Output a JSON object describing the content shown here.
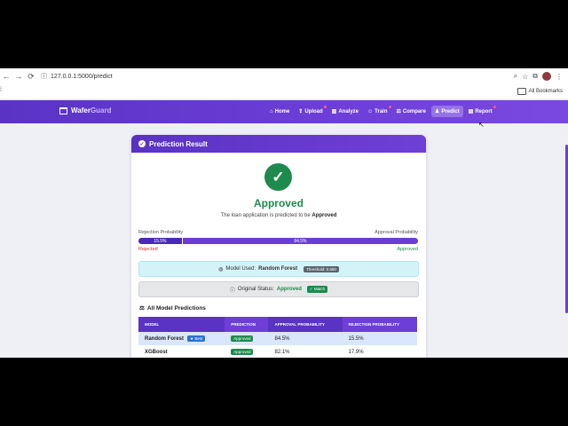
{
  "browser": {
    "url": "127.0.0.1:5000/predict",
    "bookmarks_label": "All Bookmarks"
  },
  "app": {
    "brand_a": "Wafer",
    "brand_b": "Guard",
    "nav": [
      {
        "label": "Home",
        "icon": "home-icon"
      },
      {
        "label": "Upload",
        "icon": "upload-icon"
      },
      {
        "label": "Analyze",
        "icon": "chart-icon"
      },
      {
        "label": "Train",
        "icon": "robot-icon"
      },
      {
        "label": "Compare",
        "icon": "compare-icon"
      },
      {
        "label": "Predict",
        "icon": "predict-icon"
      },
      {
        "label": "Report",
        "icon": "report-icon"
      }
    ]
  },
  "card": {
    "title": "Prediction Result",
    "result": "Approved",
    "subtitle_pre": "The loan application is predicted to be ",
    "subtitle_val": "Approved",
    "rejection_label": "Rejection Probability",
    "approval_label": "Approval Probability",
    "rejection_pct": "15.5%",
    "approval_pct": "84.5%",
    "rejection_frac": 0.155,
    "rejected_label": "Rejected",
    "approved_label": "Approved",
    "model_used_label": "Model Used:",
    "model_used_value": "Random Forest",
    "threshold": "Threshold: 0.650",
    "orig_status_label": "Original Status:",
    "orig_status_value": "Approved",
    "match_label": "Match",
    "all_predictions_title": "All Model Predictions",
    "colors": {
      "accent": "#5a33c4",
      "approved": "#1e8a4e",
      "rejected": "#c0392b"
    }
  },
  "table": {
    "headers": [
      "MODEL",
      "PREDICTION",
      "APPROVAL PROBABILITY",
      "REJECTION PROBABILITY"
    ],
    "rows": [
      {
        "model": "Random Forest",
        "badge": "Best",
        "prediction": "Approved",
        "approval": "84.5%",
        "rejection": "15.5%"
      },
      {
        "model": "XGBoost",
        "badge": "",
        "prediction": "Approved",
        "approval": "82.1%",
        "rejection": "17.9%"
      }
    ]
  }
}
